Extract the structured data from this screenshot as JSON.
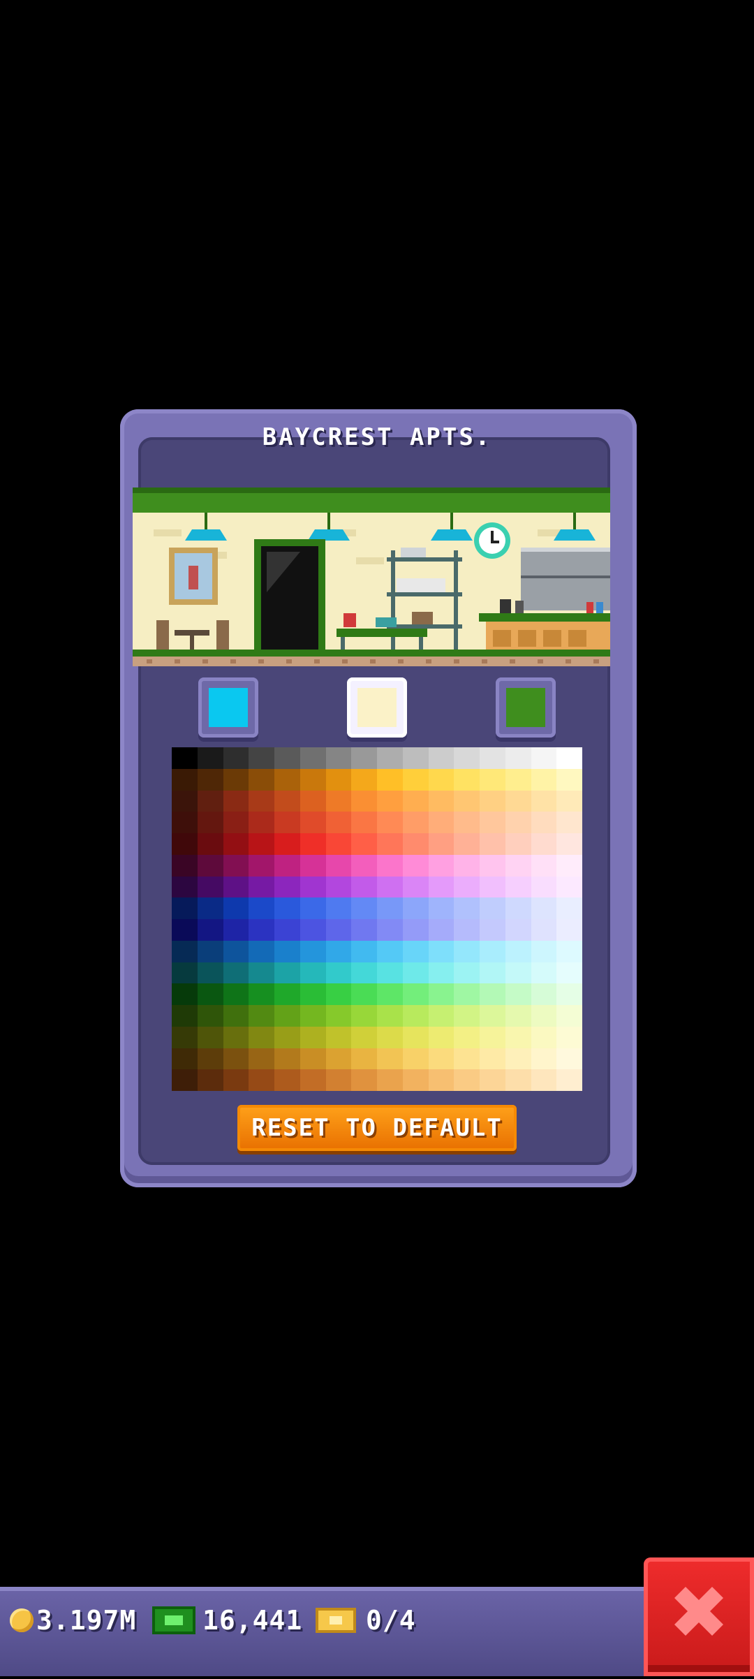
{
  "dialog": {
    "title": "BAYCREST APTS.",
    "reset_label": "RESET TO DEFAULT"
  },
  "swatches": [
    {
      "name": "primary",
      "color": "#0ac8f0",
      "selected": false
    },
    {
      "name": "wall",
      "color": "#fbf2c8",
      "selected": true
    },
    {
      "name": "trim",
      "color": "#3f8e1e",
      "selected": false
    }
  ],
  "palette": [
    [
      "#000000",
      "#1a1a1a",
      "#2e2e2e",
      "#444444",
      "#5a5a5a",
      "#707070",
      "#858585",
      "#999999",
      "#adadad",
      "#bdbdbd",
      "#cccccc",
      "#d8d8d8",
      "#e3e3e3",
      "#ececec",
      "#f5f5f5",
      "#ffffff"
    ],
    [
      "#3a1a05",
      "#4f2706",
      "#6b3a06",
      "#8a4d08",
      "#aa620a",
      "#c9780c",
      "#e2900f",
      "#f4a81b",
      "#ffbf27",
      "#ffcf3a",
      "#ffd84d",
      "#ffe262",
      "#ffe878",
      "#ffee8e",
      "#fff3a6",
      "#fff8c0"
    ],
    [
      "#3b140a",
      "#611f10",
      "#8a2a14",
      "#a83a18",
      "#c24c1c",
      "#dc6120",
      "#ee7a27",
      "#fa8f33",
      "#ff9f3f",
      "#ffae50",
      "#ffbb61",
      "#ffc672",
      "#ffd083",
      "#ffd994",
      "#ffe2a6",
      "#ffeab8"
    ],
    [
      "#3e0f0a",
      "#64170f",
      "#8a1f15",
      "#ab2a1b",
      "#c93a22",
      "#e04b2a",
      "#f06135",
      "#fa7644",
      "#ff8a55",
      "#ff9d67",
      "#ffad79",
      "#ffbb8b",
      "#ffc79c",
      "#ffd2ad",
      "#ffdcbe",
      "#ffe6ce"
    ],
    [
      "#40080a",
      "#6a0c0f",
      "#930f13",
      "#b81417",
      "#d81d1d",
      "#ef2f28",
      "#f94736",
      "#ff5f47",
      "#ff7659",
      "#ff8b6d",
      "#ff9f82",
      "#ffb196",
      "#ffc1aa",
      "#ffcfbd",
      "#ffdbcf",
      "#ffe6df"
    ],
    [
      "#3a0525",
      "#5e0a3b",
      "#820f52",
      "#a2166a",
      "#bf2281",
      "#d63297",
      "#e747ab",
      "#f35ebc",
      "#fb75cb",
      "#ff8bd7",
      "#ffa0e1",
      "#ffb3e8",
      "#ffc4ee",
      "#ffd3f3",
      "#ffe0f7",
      "#ffecfb"
    ],
    [
      "#2c0640",
      "#450a63",
      "#5e1186",
      "#761aa4",
      "#8c26bd",
      "#a035d0",
      "#b247de",
      "#c25be9",
      "#cf70f1",
      "#da85f6",
      "#e49afa",
      "#ebadfc",
      "#f1bffd",
      "#f6cffe",
      "#f9ddfe",
      "#fce9ff"
    ],
    [
      "#061a5a",
      "#0a2a86",
      "#0e39ad",
      "#1b49c9",
      "#2a59dc",
      "#3b69e8",
      "#4f7af0",
      "#6389f5",
      "#7898f8",
      "#8ca6fa",
      "#9fb4fc",
      "#b0c1fd",
      "#c0cdfd",
      "#cfd9fe",
      "#dde4fe",
      "#e9eeff"
    ],
    [
      "#0a0a58",
      "#131683",
      "#1e24a6",
      "#2b33c1",
      "#3b43d4",
      "#4c54e1",
      "#5e66ea",
      "#7078f0",
      "#828af5",
      "#949bf8",
      "#a5abfa",
      "#b5bbfc",
      "#c4c9fd",
      "#d2d6fe",
      "#dfe2fe",
      "#ebedff"
    ],
    [
      "#062a55",
      "#0a3e7a",
      "#0e549c",
      "#136ab7",
      "#1a80cc",
      "#2495dc",
      "#31a8e8",
      "#41baf0",
      "#54c9f6",
      "#68d5f9",
      "#7edffb",
      "#94e7fc",
      "#a9edfd",
      "#bcf2fe",
      "#cdf6fe",
      "#ddfaff"
    ],
    [
      "#063a3e",
      "#0a545a",
      "#0f6e76",
      "#15898f",
      "#1ca3a6",
      "#25b8ba",
      "#32cacb",
      "#44d8d8",
      "#58e2e2",
      "#6ee9e9",
      "#86efef",
      "#9cf3f3",
      "#b1f6f6",
      "#c4f9f9",
      "#d5fbfb",
      "#e5fdfd"
    ],
    [
      "#063a0a",
      "#0a5711",
      "#0f7418",
      "#168f20",
      "#1fa82a",
      "#2abd36",
      "#38cf44",
      "#4adc55",
      "#5ee667",
      "#73ee7b",
      "#89f38f",
      "#9ff7a3",
      "#b3f9b6",
      "#c5fbc7",
      "#d6fcd7",
      "#e5fee6"
    ],
    [
      "#1f3a06",
      "#2f5509",
      "#40700d",
      "#528a12",
      "#63a218",
      "#74b720",
      "#86c92b",
      "#98d739",
      "#a9e24a",
      "#b8ea5d",
      "#c6f071",
      "#d2f485",
      "#dcf79a",
      "#e5f9ae",
      "#edfbc1",
      "#f4fdd4"
    ],
    [
      "#363a06",
      "#4f5509",
      "#686f0d",
      "#818812",
      "#989e18",
      "#adb120",
      "#c0c22b",
      "#d0d039",
      "#dcdb4a",
      "#e6e45d",
      "#ede b71",
      "#f3f085",
      "#f6f39a",
      "#f9f6ae",
      "#fbf9c1",
      "#fdfbd4"
    ],
    [
      "#3f2a06",
      "#5d3d0a",
      "#7b510f",
      "#986515",
      "#b27a1c",
      "#c98e25",
      "#dba231",
      "#e9b441",
      "#f2c454",
      "#f8d168",
      "#fbdb7d",
      "#fde392",
      "#feeaa6",
      "#fef0ba",
      "#fff5cc",
      "#fff9dd"
    ],
    [
      "#3e1e08",
      "#5c2c0c",
      "#7a3a10",
      "#964a16",
      "#ad5b1d",
      "#c26d26",
      "#d28031",
      "#e0923e",
      "#eaa34d",
      "#f2b25f",
      "#f7bf71",
      "#facb84",
      "#fcd597",
      "#fddeaa",
      "#fee6bd",
      "#ffeed0"
    ]
  ],
  "status": {
    "coins": "3.197M",
    "bux": "16,441",
    "tickets": "0/4"
  }
}
